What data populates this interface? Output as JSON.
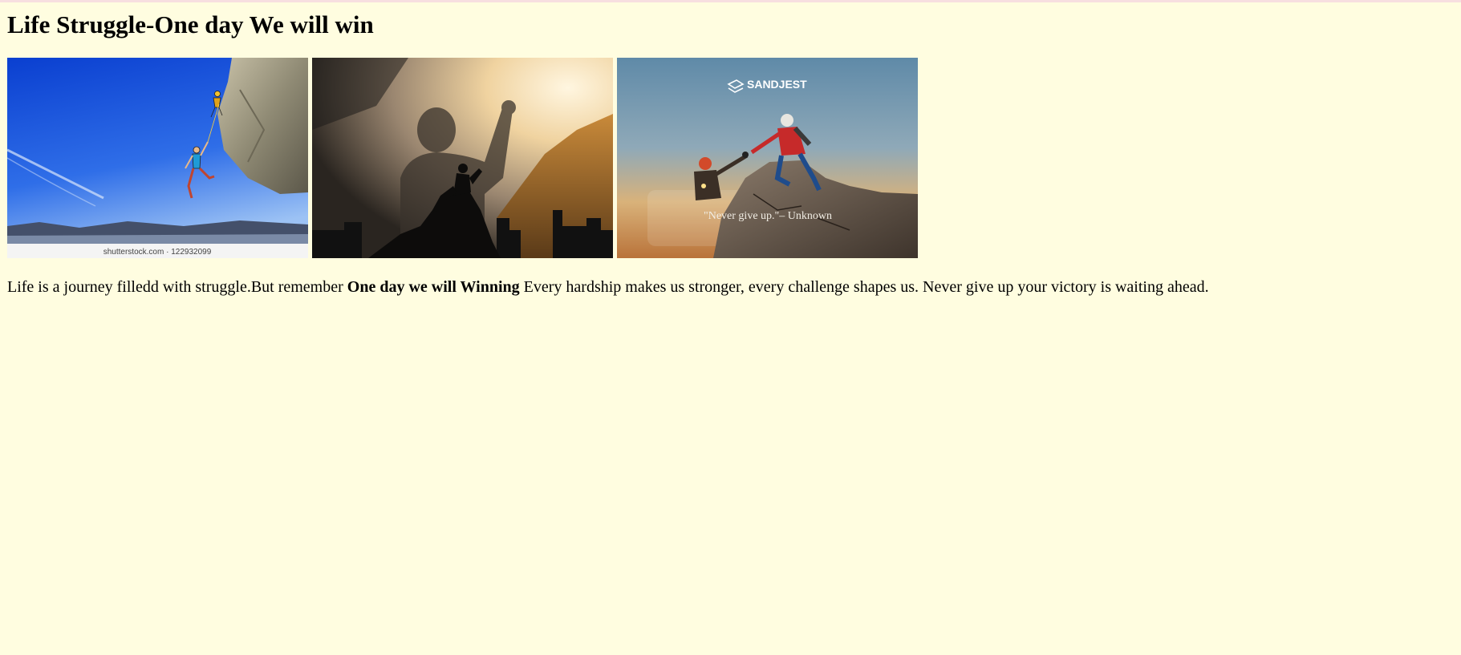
{
  "page": {
    "title": "Life Struggle-One day We will win",
    "background_color": "#fffde0"
  },
  "gallery": [
    {
      "name": "climbers-on-cliff-photo",
      "caption": "shutterstock.com · 122932099"
    },
    {
      "name": "silhouette-victory-photo"
    },
    {
      "name": "helping-hand-summit-photo",
      "brand": "SANDJEST",
      "quote": "\"Never give up.\"– Unknown"
    }
  ],
  "paragraph": {
    "before_bold": "Life is a journey filledd with struggle.But remember ",
    "bold": "One day we will Winning",
    "after_bold": " Every hardship makes us stronger, every challenge shapes us. Never give up your victory is waiting ahead."
  }
}
